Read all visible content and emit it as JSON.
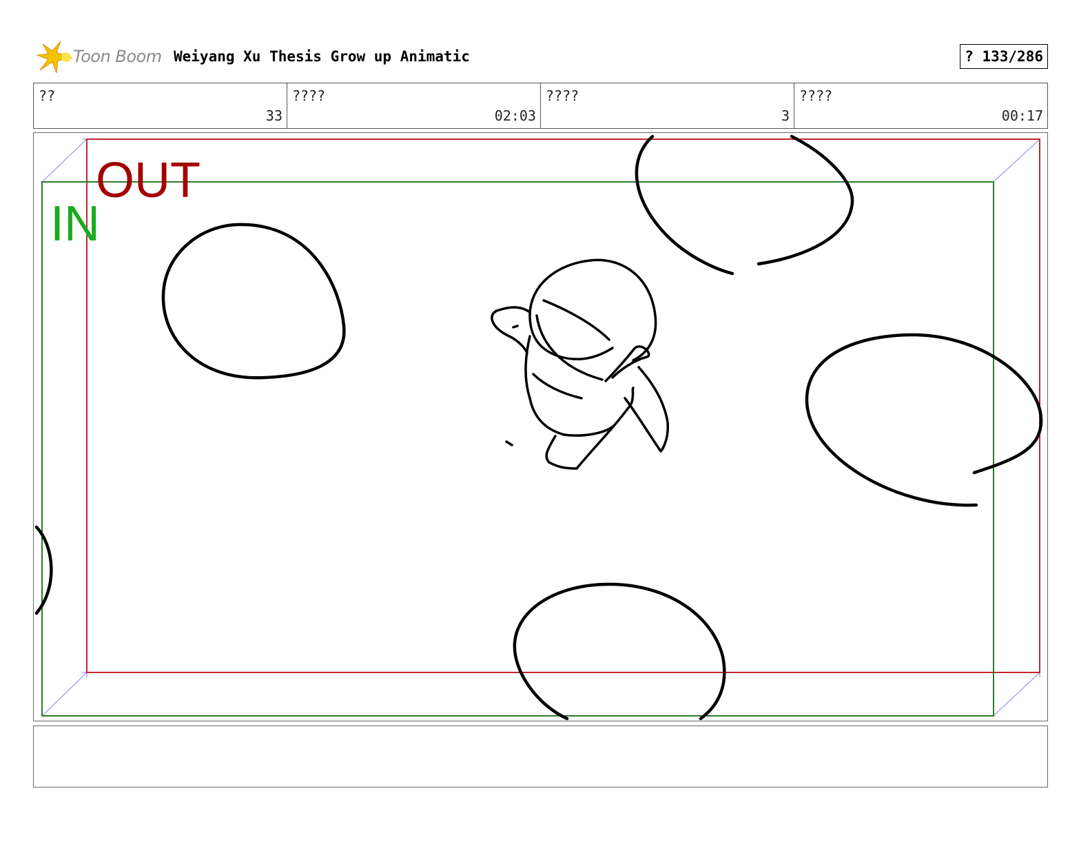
{
  "header": {
    "logo_text": "Toon Boom",
    "title": "Weiyang Xu Thesis Grow up Animatic",
    "page_counter": "? 133/286"
  },
  "info_fields": [
    {
      "label": "??",
      "value": "33"
    },
    {
      "label": "????",
      "value": "02:03"
    },
    {
      "label": "????",
      "value": "3"
    },
    {
      "label": "????",
      "value": "00:17"
    }
  ],
  "panel": {
    "out_label": "OUT",
    "in_label": "IN"
  },
  "notes": {
    "text": ""
  },
  "colors": {
    "out_frame": "#c0272d",
    "in_frame": "#2a7a2a",
    "out_text": "#a30000",
    "in_text": "#1caa1c",
    "camera_lines": "#a8a8ee",
    "logo_star": "#f5c400"
  }
}
